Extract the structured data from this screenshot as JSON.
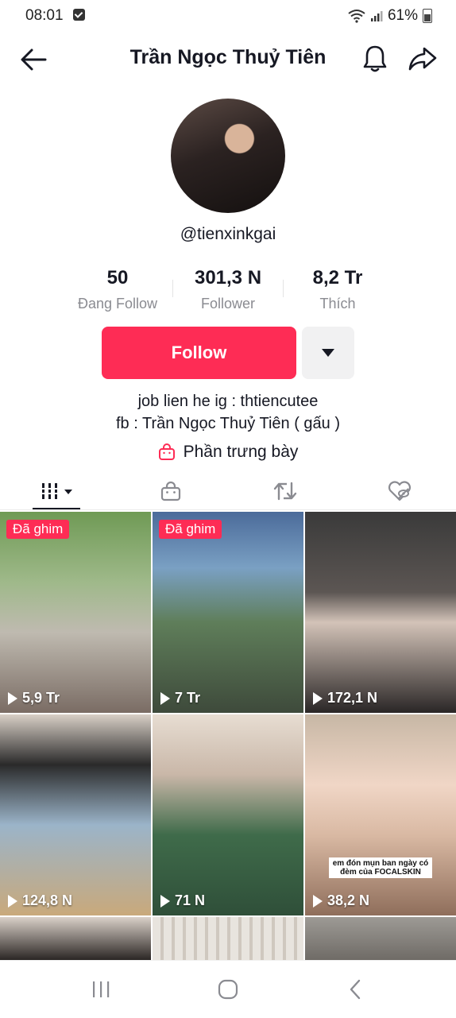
{
  "status_bar": {
    "time": "08:01",
    "battery": "61%"
  },
  "header": {
    "title": "Trần Ngọc Thuỷ Tiên"
  },
  "profile": {
    "handle": "@tienxinkgai"
  },
  "stats": [
    {
      "value": "50",
      "label": "Đang Follow"
    },
    {
      "value": "301,3 N",
      "label": "Follower"
    },
    {
      "value": "8,2 Tr",
      "label": "Thích"
    }
  ],
  "actions": {
    "follow_label": "Follow"
  },
  "bio": {
    "line1": "job lien he ig : thtiencutee",
    "line2": "fb : Trần Ngọc Thuỷ Tiên ( gấu )"
  },
  "showcase": {
    "label": "Phần trưng bày"
  },
  "grid": {
    "pinned_label": "Đã ghim",
    "videos": [
      {
        "views": "5,9 Tr",
        "pinned": true
      },
      {
        "views": "7 Tr",
        "pinned": true
      },
      {
        "views": "172,1 N",
        "pinned": false
      },
      {
        "views": "124,8 N",
        "pinned": false
      },
      {
        "views": "71 N",
        "pinned": false
      },
      {
        "views": "38,2 N",
        "pinned": false,
        "caption": "em đón mụn ban ngày có đèm của FOCALSKIN"
      }
    ]
  },
  "colors": {
    "accent": "#fe2c55",
    "text": "#161823",
    "muted": "#8a8b91"
  }
}
